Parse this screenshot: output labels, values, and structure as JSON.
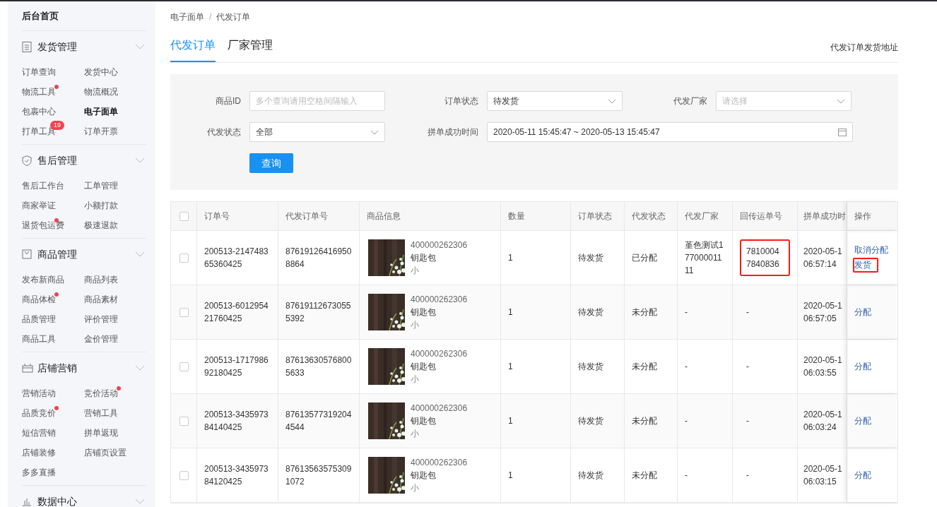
{
  "sidebar": {
    "home": "后台首页",
    "groups": [
      {
        "title": "发货管理",
        "items": [
          {
            "label": "订单查询",
            "selected": false
          },
          {
            "label": "发货中心",
            "selected": false
          },
          {
            "label": "物流工具",
            "selected": false,
            "dot": true
          },
          {
            "label": "物流概况",
            "selected": false
          },
          {
            "label": "包裹中心",
            "selected": false
          },
          {
            "label": "电子面单",
            "selected": true
          },
          {
            "label": "打单工具",
            "selected": false,
            "badge": "19"
          },
          {
            "label": "订单开票",
            "selected": false
          }
        ]
      },
      {
        "title": "售后管理",
        "items": [
          {
            "label": "售后工作台",
            "selected": false
          },
          {
            "label": "工单管理",
            "selected": false
          },
          {
            "label": "商家举证",
            "selected": false
          },
          {
            "label": "小额打款",
            "selected": false
          },
          {
            "label": "退货包运费",
            "selected": false,
            "dot": true
          },
          {
            "label": "极速退款",
            "selected": false
          }
        ]
      },
      {
        "title": "商品管理",
        "items": [
          {
            "label": "发布新商品",
            "selected": false
          },
          {
            "label": "商品列表",
            "selected": false
          },
          {
            "label": "商品体检",
            "selected": false,
            "dot": true
          },
          {
            "label": "商品素材",
            "selected": false
          },
          {
            "label": "品质管理",
            "selected": false
          },
          {
            "label": "评价管理",
            "selected": false
          },
          {
            "label": "商品工具",
            "selected": false
          },
          {
            "label": "金价管理",
            "selected": false
          }
        ]
      },
      {
        "title": "店铺营销",
        "items": [
          {
            "label": "营销活动",
            "selected": false
          },
          {
            "label": "竞价活动",
            "selected": false,
            "dot": true
          },
          {
            "label": "品质竞价",
            "selected": false,
            "dot": true
          },
          {
            "label": "营销工具",
            "selected": false
          },
          {
            "label": "短信营销",
            "selected": false
          },
          {
            "label": "拼单返现",
            "selected": false
          },
          {
            "label": "店铺装修",
            "selected": false
          },
          {
            "label": "店铺页设置",
            "selected": false
          },
          {
            "label": "多多直播",
            "selected": false
          }
        ]
      },
      {
        "title": "数据中心"
      }
    ]
  },
  "breadcrumb": [
    "电子面单",
    "代发订单"
  ],
  "breadcrumb_separator": "/",
  "tabs": [
    {
      "label": "代发订单",
      "selected": true
    },
    {
      "label": "厂家管理",
      "selected": false
    }
  ],
  "top_link": "代发订单发货地址",
  "filters": {
    "product_id": {
      "label": "商品ID",
      "placeholder": "多个查询请用空格间隔输入"
    },
    "order_status": {
      "label": "订单状态",
      "value": "待发货"
    },
    "factory": {
      "label": "代发厂家",
      "placeholder": "请选择"
    },
    "dropship_status": {
      "label": "代发状态",
      "value": "全部"
    },
    "group_time": {
      "label": "拼单成功时间",
      "value": "2020-05-11 15:45:47 ~ 2020-05-13 15:45:47"
    },
    "query_button": "查询"
  },
  "table": {
    "header_checked": false,
    "columns": [
      "订单号",
      "代发订单号",
      "商品信息",
      "数量",
      "订单状态",
      "代发状态",
      "代发厂家",
      "回传运单号",
      "拼单成功时",
      "操作"
    ],
    "rows": [
      {
        "checked": false,
        "order_no": "200513-214748365360425",
        "dropship_no": "876191264169508864",
        "product": {
          "kind": "picture",
          "sku": "400000262306",
          "name": "钥匙包",
          "spec": "小"
        },
        "quantity": "1",
        "order_status": "待发货",
        "dropship_status": "已分配",
        "factory": "堇色测试17700001111",
        "tracking_no": "78100047840836",
        "tracking_highlighted": true,
        "date": "2020-05-1",
        "time": "06:57:14",
        "actions": [
          {
            "label": "取消分配",
            "highlighted": false
          },
          {
            "label": "发货",
            "highlighted": true
          }
        ]
      },
      {
        "checked": false,
        "order_no": "200513-601295421760425",
        "dropship_no": "876191126730555392",
        "product": {
          "kind": "picture",
          "sku": "400000262306",
          "name": "钥匙包",
          "spec": "小"
        },
        "quantity": "1",
        "order_status": "待发货",
        "dropship_status": "未分配",
        "factory": "-",
        "tracking_no": "-",
        "tracking_highlighted": false,
        "date": "2020-05-1",
        "time": "06:57:05",
        "actions": [
          {
            "label": "分配",
            "highlighted": false
          }
        ]
      },
      {
        "checked": false,
        "order_no": "200513-171798692180425",
        "dropship_no": "876136305768005633",
        "product": {
          "kind": "picture",
          "sku": "400000262306",
          "name": "钥匙包",
          "spec": "小"
        },
        "quantity": "1",
        "order_status": "待发货",
        "dropship_status": "未分配",
        "factory": "-",
        "tracking_no": "-",
        "tracking_highlighted": false,
        "date": "2020-05-1",
        "time": "06:03:55",
        "actions": [
          {
            "label": "分配",
            "highlighted": false
          }
        ]
      },
      {
        "checked": false,
        "order_no": "200513-343597384140425",
        "dropship_no": "876135773192044544",
        "product": {
          "kind": "picture",
          "sku": "400000262306",
          "name": "钥匙包",
          "spec": "小"
        },
        "quantity": "1",
        "order_status": "待发货",
        "dropship_status": "未分配",
        "factory": "-",
        "tracking_no": "-",
        "tracking_highlighted": false,
        "date": "2020-05-1",
        "time": "06:03:24",
        "actions": [
          {
            "label": "分配",
            "highlighted": false
          }
        ]
      },
      {
        "checked": false,
        "order_no": "200513-343597384120425",
        "dropship_no": "876135635753091072",
        "product": {
          "kind": "picture",
          "sku": "400000262306",
          "name": "钥匙包",
          "spec": "小"
        },
        "quantity": "1",
        "order_status": "待发货",
        "dropship_status": "未分配",
        "factory": "-",
        "tracking_no": "-",
        "tracking_highlighted": false,
        "date": "2020-05-1",
        "time": "06:03:15",
        "actions": [
          {
            "label": "分配",
            "highlighted": false
          }
        ]
      }
    ]
  }
}
